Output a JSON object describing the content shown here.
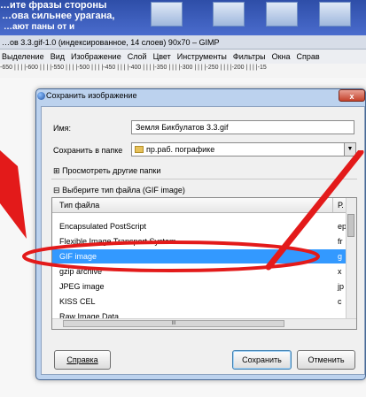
{
  "background_doc": {
    "line1": "…ите фразы стороны",
    "line2": "…ова сильнее урагана,",
    "line3": "…ают паны от и"
  },
  "window": {
    "title": "…ов 3.3.gif-1.0 (индексированное, 14 слоев) 90x70 – GIMP"
  },
  "menubar": {
    "items": [
      "Выделение",
      "Вид",
      "Изображение",
      "Слой",
      "Цвет",
      "Инструменты",
      "Фильтры",
      "Окна",
      "Справ"
    ]
  },
  "ruler": {
    "ticks": "-650 | | | |-600 | | | |-550 | | | |-500 | | | |-450 | | | |-400 | | | |-350 | | | |-300 | | | |-250 | | | |-200 | | | |-15"
  },
  "dialog": {
    "title": "Сохранить изображение",
    "close_label": "x",
    "name_label": "Имя:",
    "name_value": "Земля Бикбулатов 3.3.gif",
    "save_in_label": "Сохранить в папке",
    "folder_value": "пр.раб. пографике",
    "browse_label": "Просмотреть другие папки",
    "filetype_label": "Выберите тип файла (GIF image)",
    "list_header_type": "Тип файла",
    "list_header_ext": "Р.",
    "scroll_label": "III",
    "help_button": "Справка",
    "save_button": "Сохранить",
    "cancel_button": "Отменить"
  },
  "file_types": [
    {
      "name": "Encapsulated PostScript",
      "ext": "ер"
    },
    {
      "name": "Flexible Image Transport System",
      "ext": "fr"
    },
    {
      "name": "GIF image",
      "ext": "g"
    },
    {
      "name": "gzip archive",
      "ext": "x"
    },
    {
      "name": "JPEG image",
      "ext": "jp"
    },
    {
      "name": "KISS CEL",
      "ext": "c"
    },
    {
      "name": "Raw Image Data",
      "ext": ""
    }
  ],
  "colors": {
    "annotation_red": "#e31a1a",
    "selection": "#3399ff"
  },
  "icons": [
    "gimp-icon",
    "folder-icon",
    "close-icon",
    "expand-icon",
    "chevron-down-icon",
    "arrow-icon"
  ]
}
